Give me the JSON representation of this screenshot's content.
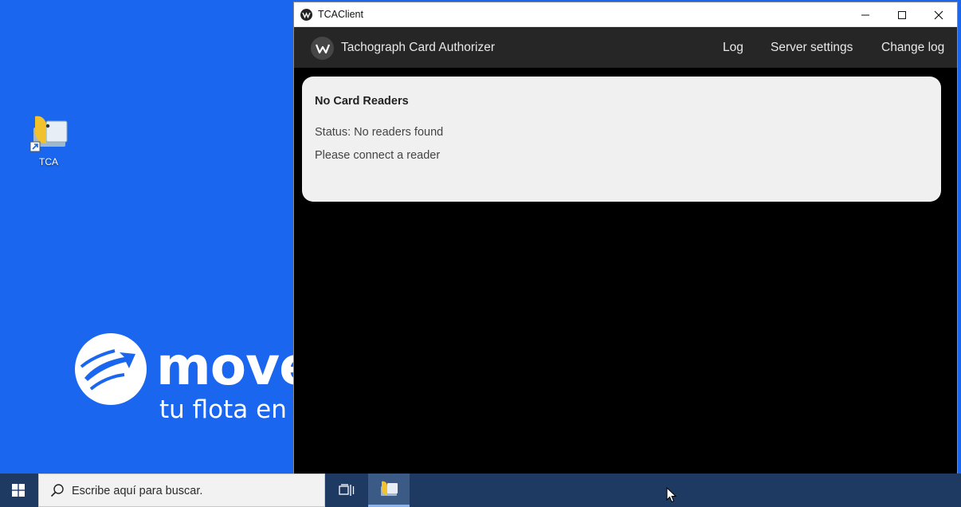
{
  "desktop": {
    "icon_label": "TCA",
    "brand_word": "move",
    "brand_tagline": "tu flota en"
  },
  "window": {
    "title": "TCAClient",
    "app_name": "Tachograph Card Authorizer",
    "nav": {
      "log": "Log",
      "server_settings": "Server settings",
      "change_log": "Change log"
    },
    "card": {
      "heading": "No Card Readers",
      "status": "Status: No readers found",
      "message": "Please connect a reader"
    },
    "buttons": {
      "minimize_icon": "minimize-icon",
      "maximize_icon": "maximize-icon",
      "close_icon": "close-icon"
    }
  },
  "taskbar": {
    "search_placeholder": "Escribe aquí para buscar.",
    "start_icon": "windows-logo-icon",
    "task_view_icon": "task-view-icon"
  },
  "colors": {
    "desktop_bg": "#1b66ee",
    "appbar_bg": "#262626",
    "window_bg": "#000000",
    "card_bg": "#f0f0f0",
    "taskbar_bg": "#1e3a63"
  }
}
